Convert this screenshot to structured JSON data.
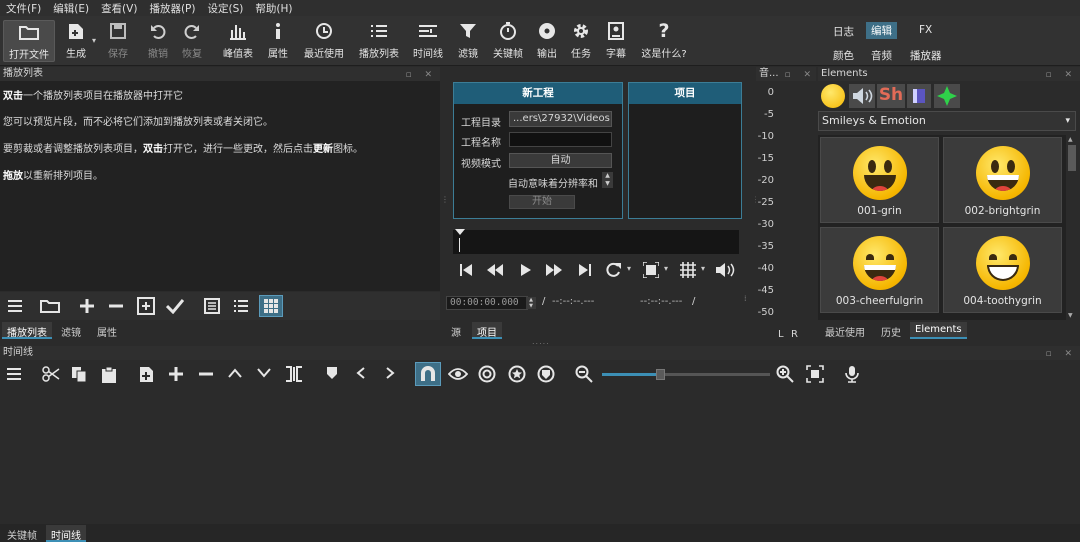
{
  "menu": [
    "文件(F)",
    "编辑(E)",
    "查看(V)",
    "播放器(P)",
    "设定(S)",
    "帮助(H)"
  ],
  "toolbar": {
    "open_file": "打开文件",
    "generate": "生成",
    "save": "保存",
    "undo": "撤销",
    "redo": "恢复",
    "peak": "峰值表",
    "properties": "属性",
    "recent": "最近使用",
    "playlist": "播放列表",
    "timeline": "时间线",
    "filters": "滤镜",
    "keyframes": "关键帧",
    "output": "输出",
    "jobs": "任务",
    "subtitles": "字幕",
    "whats_this": "这是什么?"
  },
  "layout_tabs": {
    "log": "日志",
    "edit": "编辑",
    "fx": "FX",
    "color": "颜色",
    "audio": "音频",
    "player": "播放器"
  },
  "playlist": {
    "title": "播放列表",
    "line1_bold": "双击",
    "line1_rest": "一个播放列表项目在播放器中打开它",
    "line2": "您可以预览片段，而不必将它们添加到播放列表或者关闭它。",
    "line3_a": "要剪裁或者调整播放列表项目，",
    "line3_bold1": "双击",
    "line3_b": "打开它，进行一些更改，然后点击",
    "line3_bold2": "更新",
    "line3_c": "图标。",
    "line4_bold": "拖放",
    "line4_rest": "以重新排列项目。",
    "tabs": [
      "播放列表",
      "滤镜",
      "属性"
    ]
  },
  "new_project": {
    "title": "新工程",
    "dir_label": "工程目录",
    "dir_value": "...ers\\27932\\Videos",
    "name_label": "工程名称",
    "name_value": "",
    "mode_label": "视频模式",
    "mode_value": "自动",
    "auto_res": "自动意味着分辨率和",
    "start": "开始"
  },
  "projects": {
    "title": "项目"
  },
  "player": {
    "timecode": "00:00:00.000",
    "sep1": "/",
    "in_point": "--:--:--.---",
    "out_point": "--:--:--.---",
    "sep2": "/",
    "tabs": [
      "源",
      "项目"
    ]
  },
  "meter": {
    "title": "音...",
    "scale": [
      "0",
      "-5",
      "-10",
      "-15",
      "-20",
      "-25",
      "-30",
      "-35",
      "-40",
      "-45",
      "-50"
    ],
    "left": "L",
    "right": "R"
  },
  "elements": {
    "title": "Elements",
    "category": "Smileys & Emotion",
    "items": [
      {
        "name": "001-grin"
      },
      {
        "name": "002-brightgrin"
      },
      {
        "name": "003-cheerfulgrin"
      },
      {
        "name": "004-toothygrin"
      }
    ],
    "tabs": [
      "最近使用",
      "历史",
      "Elements"
    ],
    "sh_label": "Sh"
  },
  "timeline": {
    "title": "时间线"
  },
  "bottom_tabs": [
    "关键帧",
    "时间线"
  ],
  "colors": {
    "accent": "#3c8fb5",
    "panel_header_blue": "#1f5d78",
    "snap_active": "#3e6f87"
  }
}
